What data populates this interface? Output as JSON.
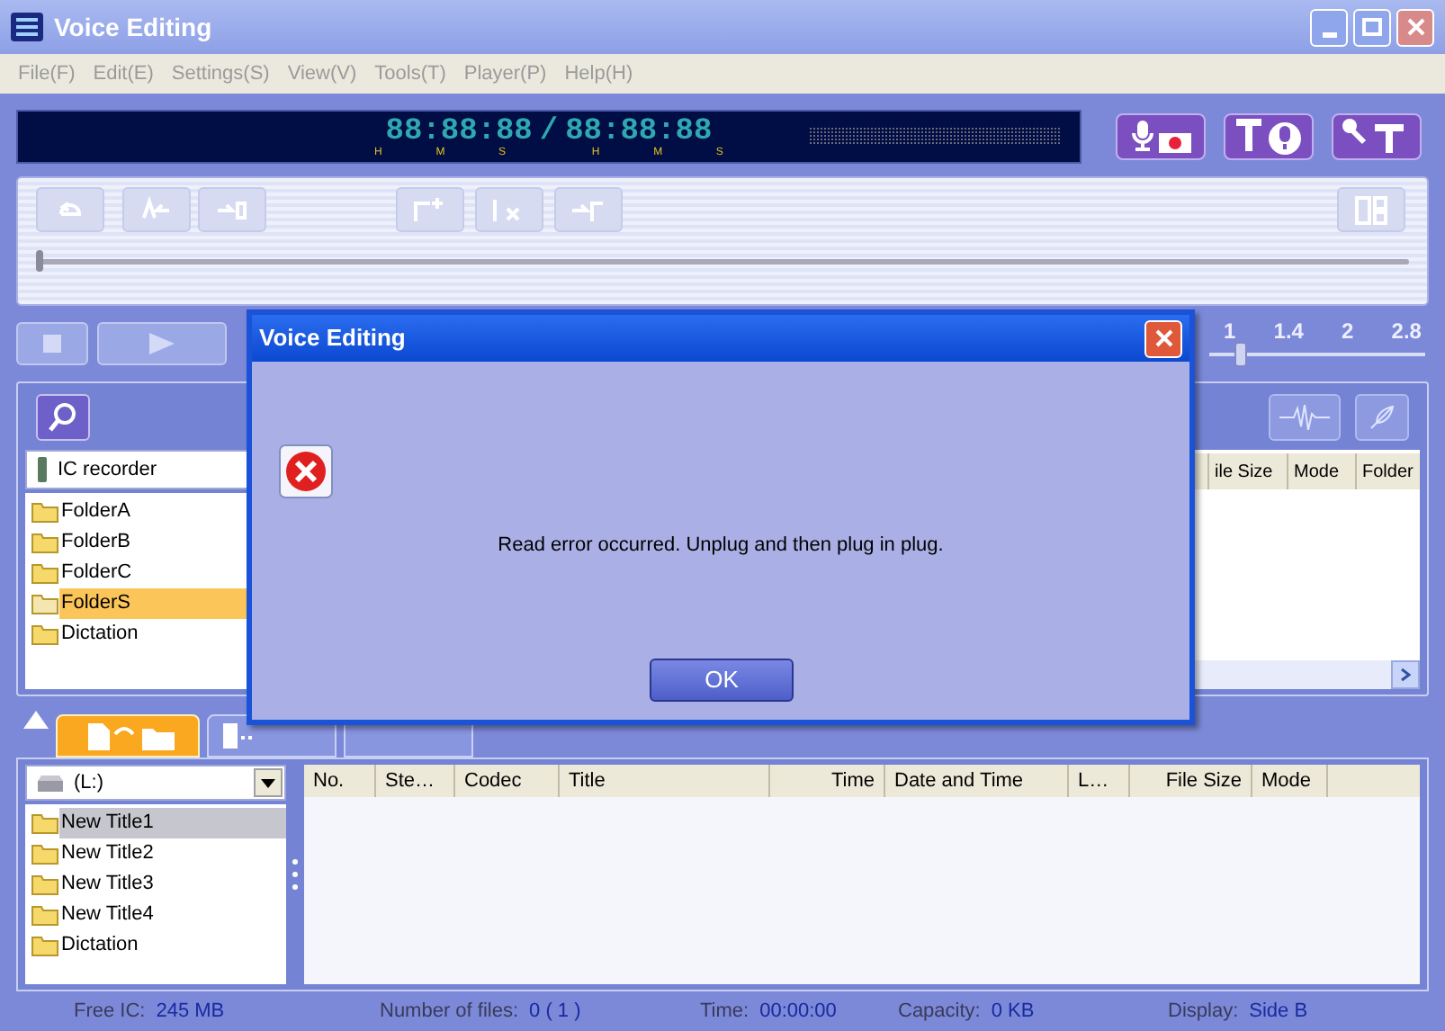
{
  "window": {
    "title": "Voice Editing"
  },
  "menu": [
    {
      "label": "File(F)"
    },
    {
      "label": "Edit(E)"
    },
    {
      "label": "Settings(S)"
    },
    {
      "label": "View(V)"
    },
    {
      "label": "Tools(T)"
    },
    {
      "label": "Player(P)"
    },
    {
      "label": "Help(H)"
    }
  ],
  "time_display": {
    "elapsed": "88:88:88",
    "separator": "/",
    "total": "88:88:88",
    "units": [
      "H",
      "M",
      "S",
      "H",
      "M",
      "S"
    ]
  },
  "mode_buttons": [
    {
      "kind": "record"
    },
    {
      "kind": "text-to-voice"
    },
    {
      "kind": "voice-to-text"
    }
  ],
  "edit_toolbar": [
    {
      "kind": "loop",
      "disabled": true
    },
    {
      "kind": "a-point",
      "disabled": true
    },
    {
      "kind": "b-point",
      "disabled": true
    },
    {
      "kind": "add-mark",
      "disabled": true
    },
    {
      "kind": "delete-mark",
      "disabled": true
    },
    {
      "kind": "jump-mark",
      "disabled": true
    },
    {
      "kind": "split",
      "disabled": true
    }
  ],
  "position_slider": {
    "level": 0
  },
  "speed_scale": {
    "labels": [
      "1",
      "1.4",
      "2",
      "2.8"
    ],
    "level": 0.12
  },
  "upper_tree": {
    "header": "IC recorder",
    "items": [
      {
        "label": "FolderA",
        "selected": false
      },
      {
        "label": "FolderB",
        "selected": false
      },
      {
        "label": "FolderC",
        "selected": false
      },
      {
        "label": "FolderS",
        "selected": true
      },
      {
        "label": "Dictation",
        "selected": false
      }
    ]
  },
  "upper_table": {
    "columns": [
      "ile Size",
      "Mode",
      "Folder"
    ]
  },
  "lower_tree": {
    "drive": "(L:)",
    "items": [
      {
        "label": "New Title1",
        "selected": true
      },
      {
        "label": "New Title2",
        "selected": false
      },
      {
        "label": "New Title3",
        "selected": false
      },
      {
        "label": "New Title4",
        "selected": false
      },
      {
        "label": "Dictation",
        "selected": false
      }
    ]
  },
  "lower_table": {
    "columns": [
      "No.",
      "Ste…",
      "Codec",
      "Title",
      "Time",
      "Date and Time",
      "L…",
      "File Size",
      "Mode"
    ]
  },
  "status_bar": [
    {
      "label": "Free IC:",
      "value": "245 MB"
    },
    {
      "label": "Number of files:",
      "value": "0 ( 1 )"
    },
    {
      "label": "Time:",
      "value": "00:00:00"
    },
    {
      "label": "Capacity:",
      "value": "0 KB"
    },
    {
      "label": "Display:",
      "value": "Side B"
    }
  ],
  "dialog": {
    "title": "Voice Editing",
    "message": "Read error occurred. Unplug and then plug in plug.",
    "button": "OK"
  }
}
